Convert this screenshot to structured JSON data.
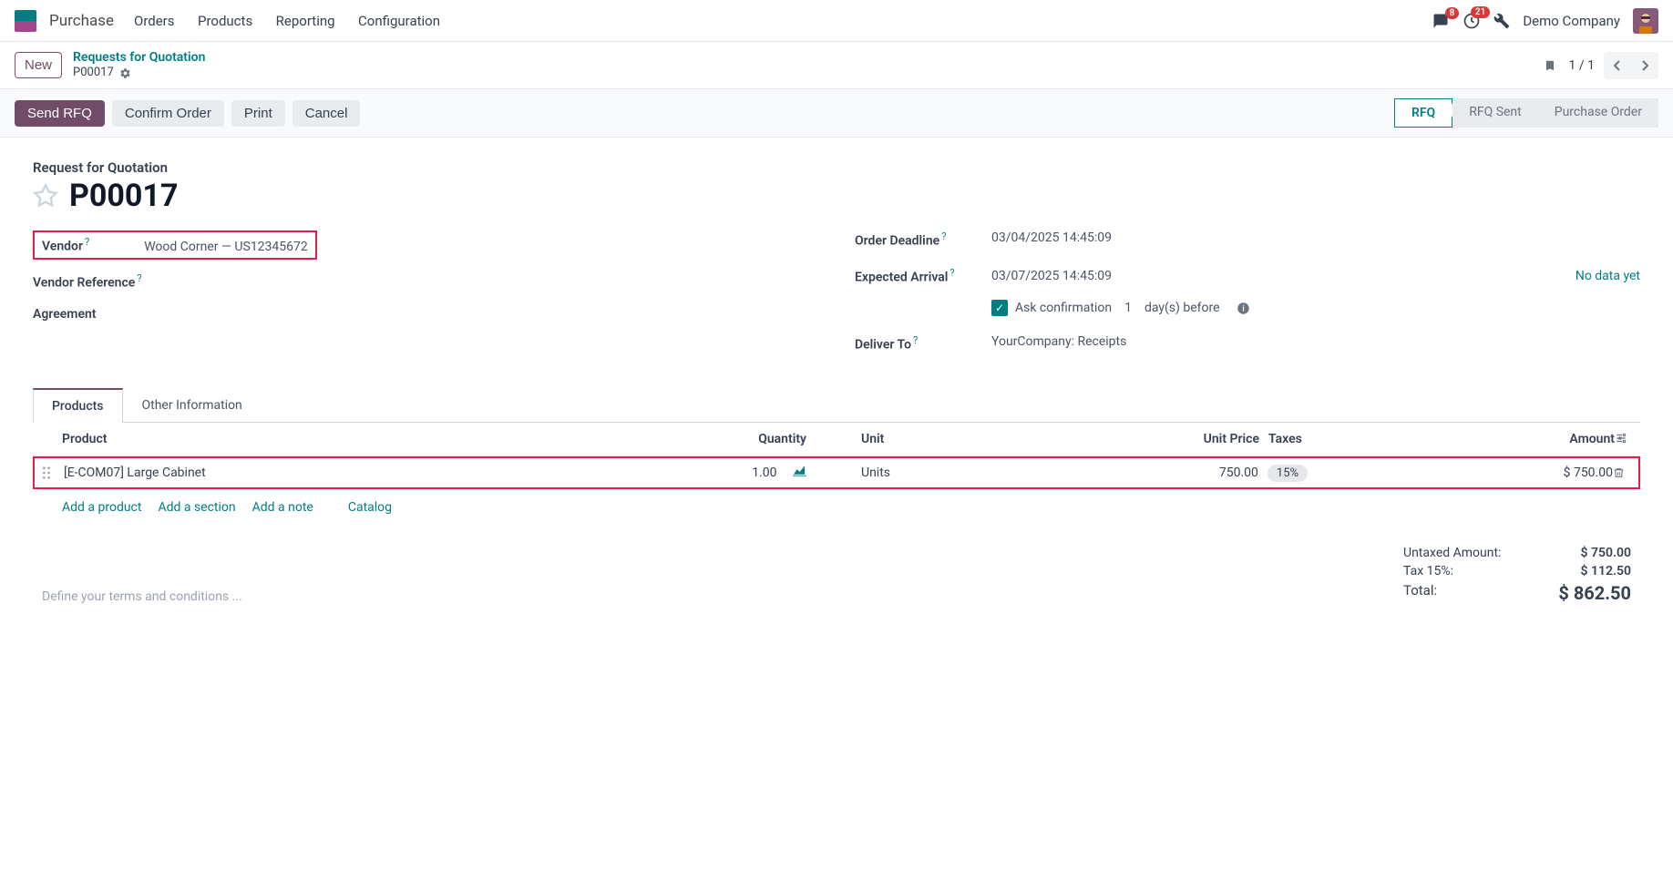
{
  "topnav": {
    "app": "Purchase",
    "items": [
      "Orders",
      "Products",
      "Reporting",
      "Configuration"
    ]
  },
  "badges": {
    "messages": "8",
    "activities": "21"
  },
  "company": "Demo Company",
  "breadcrumb": {
    "parent": "Requests for Quotation",
    "current": "P00017"
  },
  "new_btn": "New",
  "pager": "1 / 1",
  "actions": {
    "send": "Send RFQ",
    "confirm": "Confirm Order",
    "print": "Print",
    "cancel": "Cancel"
  },
  "status": [
    "RFQ",
    "RFQ Sent",
    "Purchase Order"
  ],
  "doc": {
    "label": "Request for Quotation",
    "number": "P00017"
  },
  "fields": {
    "vendor_label": "Vendor",
    "vendor_value": "Wood Corner — US12345672",
    "ref_label": "Vendor Reference",
    "agreement_label": "Agreement",
    "deadline_label": "Order Deadline",
    "deadline_value": "03/04/2025 14:45:09",
    "expected_label": "Expected Arrival",
    "expected_value": "03/07/2025 14:45:09",
    "no_data": "No data yet",
    "ask_confirm": "Ask confirmation",
    "days_value": "1",
    "days_after": "day(s) before",
    "deliver_label": "Deliver To",
    "deliver_value": "YourCompany: Receipts"
  },
  "tabs": [
    "Products",
    "Other Information"
  ],
  "table": {
    "headers": {
      "product": "Product",
      "qty": "Quantity",
      "unit": "Unit",
      "price": "Unit Price",
      "taxes": "Taxes",
      "amount": "Amount"
    },
    "row": {
      "product": "[E-COM07] Large Cabinet",
      "qty": "1.00",
      "unit": "Units",
      "price": "750.00",
      "tax": "15%",
      "amount": "$ 750.00"
    }
  },
  "add_links": {
    "product": "Add a product",
    "section": "Add a section",
    "note": "Add a note",
    "catalog": "Catalog"
  },
  "terms_placeholder": "Define your terms and conditions ...",
  "totals": {
    "untaxed_label": "Untaxed Amount:",
    "untaxed": "$ 750.00",
    "tax_label": "Tax 15%:",
    "tax": "$ 112.50",
    "total_label": "Total:",
    "total": "$ 862.50"
  }
}
